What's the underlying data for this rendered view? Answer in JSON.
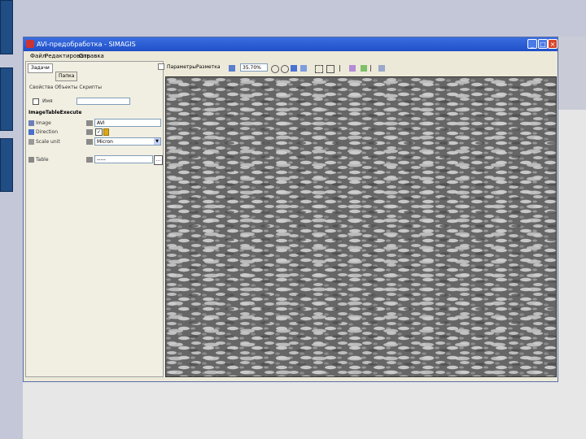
{
  "window": {
    "title": "AVI-предобработка - SIMAGIS",
    "menu": [
      "Файл",
      "Редактировать",
      "Справка"
    ]
  },
  "left_panel": {
    "tabs": [
      "Задачи",
      "Папка"
    ],
    "subtabs_text": "Свойства Объекты Скрипты",
    "name_label": "Имя",
    "name_value": "",
    "section_title": "ImageTableExecute",
    "rows": [
      {
        "icon": "image-icon",
        "label": "Image",
        "value": "AVI"
      },
      {
        "icon": "grid-icon",
        "label": "Direction",
        "value": "✓"
      },
      {
        "icon": "scale-icon",
        "label": "Scale unit",
        "value": "Micron"
      },
      {
        "icon": "table-icon",
        "label": "Table",
        "value": "-----"
      }
    ]
  },
  "toolbar": {
    "label1": "Параметры",
    "label2": "Разметка",
    "zoom": "35.70%"
  },
  "colors": {
    "slide_bg": "#c4c7d8",
    "stripe": "#1f4d84",
    "title_bar": "#1f4fc7",
    "panel_bg": "#f1efe2"
  }
}
